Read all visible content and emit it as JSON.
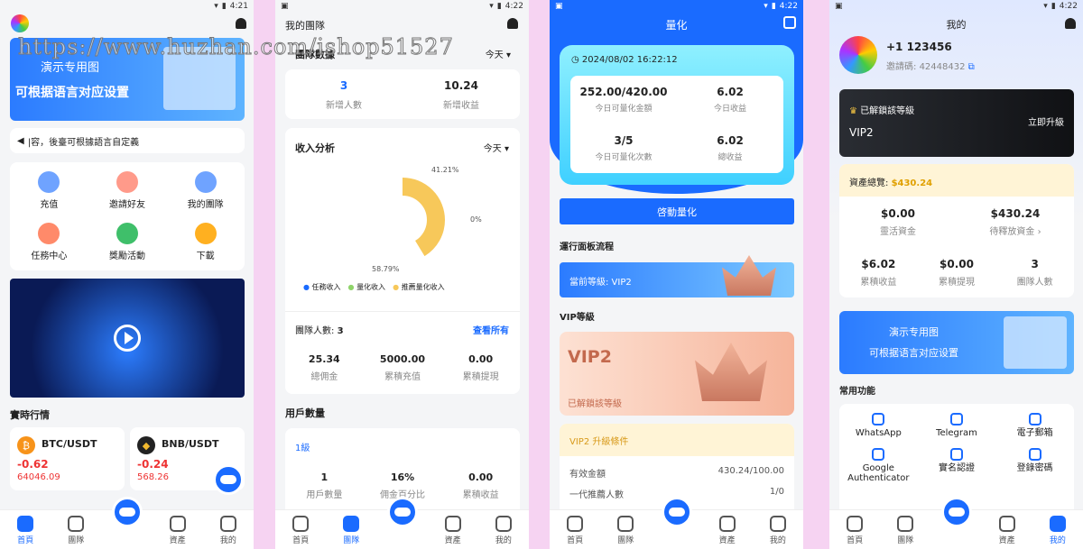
{
  "watermark": "https://www.huzhan.com/ishop51527",
  "status": {
    "time1": "4:21",
    "time2": "4:22",
    "time3": "4:22",
    "time4": "4:22"
  },
  "tabs": [
    "首頁",
    "團隊",
    "資產",
    "我的"
  ],
  "s1": {
    "banner_title": "演示专用图",
    "banner_sub": "可根据语言对应设置",
    "notice": "|容，後臺可根據語言自定義",
    "grid": [
      "充值",
      "邀請好友",
      "我的團隊",
      "任務中心",
      "獎勵活動",
      "下載"
    ],
    "market_title": "實時行情",
    "coins": [
      {
        "name": "BTC/USDT",
        "change": "-0.62",
        "price": "64046.09"
      },
      {
        "name": "BNB/USDT",
        "change": "-0.24",
        "price": "568.26"
      }
    ]
  },
  "s2": {
    "title": "我的團隊",
    "team_data": "團隊數據",
    "today": "今天",
    "new_people": "3",
    "new_people_lbl": "新增人數",
    "new_income": "10.24",
    "new_income_lbl": "新增收益",
    "income_analysis": "收入分析",
    "pct1": "41.21%",
    "pct2": "0%",
    "pct3": "58.79%",
    "legend": [
      "任務收入",
      "量化收入",
      "推薦量化收入"
    ],
    "team_count_lbl": "團隊人數:",
    "team_count": "3",
    "view_all": "查看所有",
    "stats": [
      {
        "v": "25.34",
        "l": "總佣金"
      },
      {
        "v": "5000.00",
        "l": "累積充值"
      },
      {
        "v": "0.00",
        "l": "累積提現"
      }
    ],
    "user_count": "用戶數量",
    "level": "1級",
    "ustats": [
      {
        "v": "1",
        "l": "用戶數量"
      },
      {
        "v": "16%",
        "l": "佣金百分比"
      },
      {
        "v": "0.00",
        "l": "累積收益"
      }
    ]
  },
  "s3": {
    "title": "量化",
    "datetime": "2024/08/02 16:22:12",
    "cells": [
      {
        "v": "252.00/420.00",
        "l": "今日可量化金額"
      },
      {
        "v": "6.02",
        "l": "今日收益"
      },
      {
        "v": "3/5",
        "l": "今日可量化次數"
      },
      {
        "v": "6.02",
        "l": "總收益"
      }
    ],
    "start": "啓動量化",
    "flow": "運行面板流程",
    "current": "當前等級: VIP2",
    "vip_title": "VIP等級",
    "vip_name": "VIP2",
    "vip_unlocked": "已解鎖該等級",
    "upgrade": "VIP2 升級條件",
    "cond": [
      {
        "l": "有效金額",
        "v": "430.24/100.00"
      },
      {
        "l": "一代推薦人數",
        "v": "1/0"
      }
    ]
  },
  "s4": {
    "title": "我的",
    "phone": "+1 123456",
    "invite_lbl": "邀請碼:",
    "invite": "42448432",
    "vip_unlocked": "已解鎖該等級",
    "upgrade_now": "立即升級",
    "vip": "VIP2",
    "total_lbl": "資產總覽:",
    "total": "$430.24",
    "a": [
      {
        "v": "$0.00",
        "l": "靈活資金"
      },
      {
        "v": "$430.24",
        "l": "待釋放資金 ›"
      },
      {
        "v": "$6.02",
        "l": "累積收益"
      },
      {
        "v": "$0.00",
        "l": "累積提現"
      },
      {
        "v": "3",
        "l": "團隊人數"
      }
    ],
    "banner_title": "演示专用图",
    "banner_sub": "可根据语言对应设置",
    "common": "常用功能",
    "funcs": [
      "WhatsApp",
      "Telegram",
      "電子郵箱",
      "Google Authenticator",
      "實名認證",
      "登錄密碼"
    ]
  }
}
